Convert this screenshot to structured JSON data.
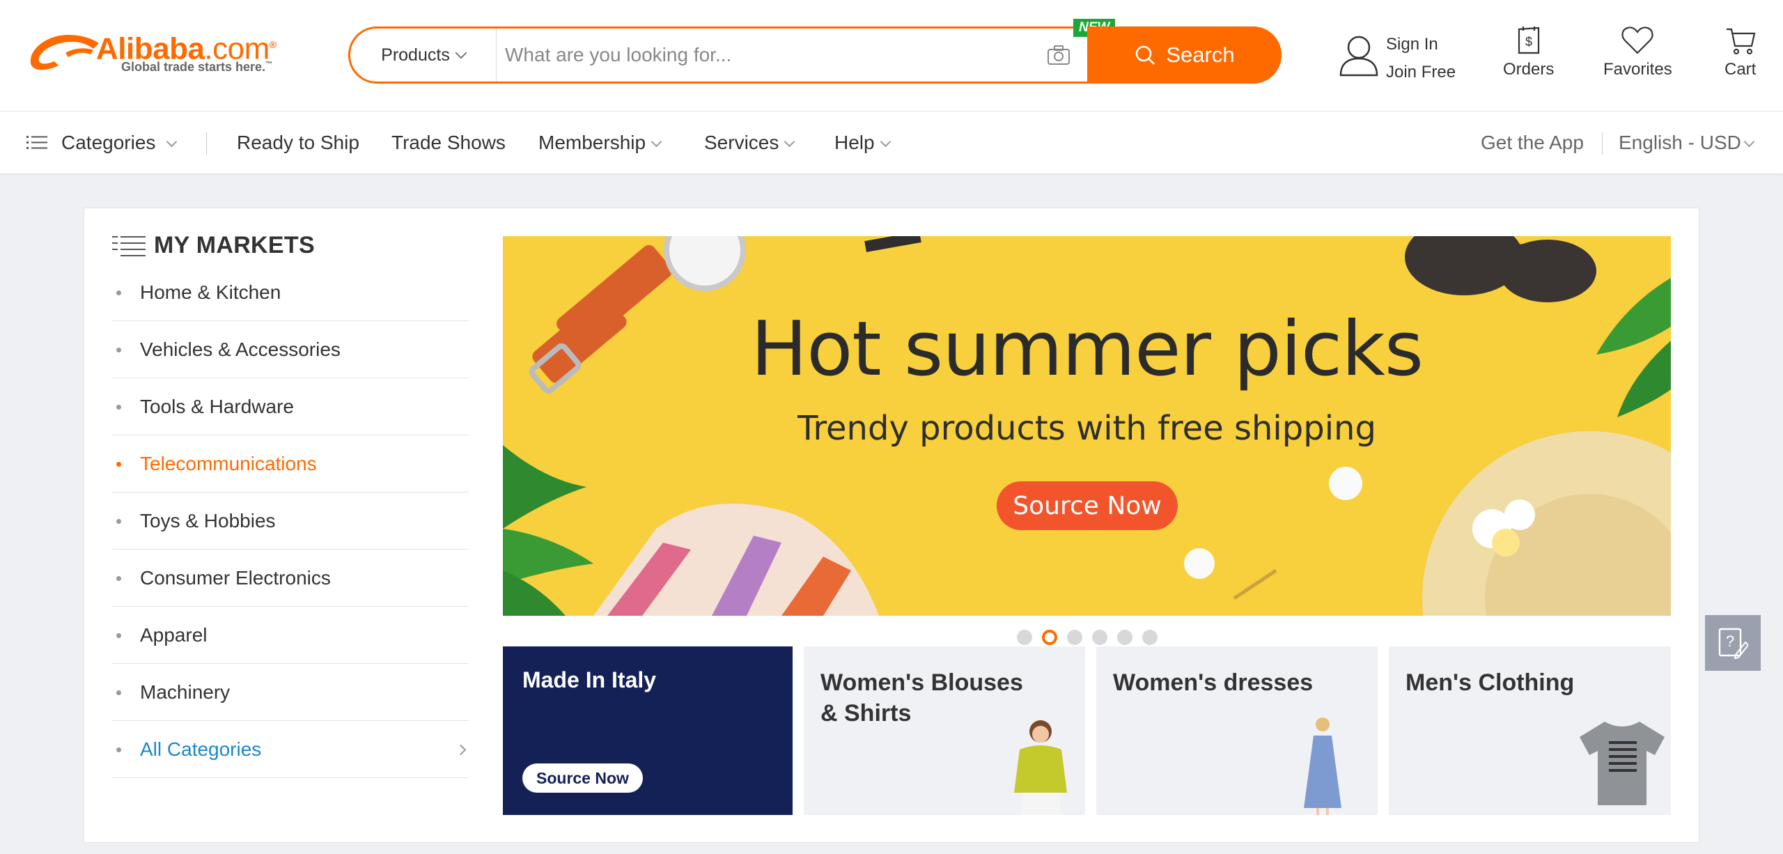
{
  "brand": {
    "logo_text": "Alibaba",
    "logo_domain": ".com",
    "logo_registered": "®",
    "tagline": "Global trade starts here.",
    "tagline_tm": "™",
    "color": "#ff6a00"
  },
  "search": {
    "category": "Products",
    "placeholder": "What are you looking for...",
    "new_badge": "NEW",
    "button_label": "Search"
  },
  "header_tools": {
    "sign_in": "Sign In",
    "join_free": "Join Free",
    "orders": "Orders",
    "favorites": "Favorites",
    "cart": "Cart"
  },
  "nav": {
    "categories": "Categories",
    "ready_to_ship": "Ready to Ship",
    "trade_shows": "Trade Shows",
    "membership": "Membership",
    "services": "Services",
    "help": "Help",
    "get_app": "Get the App",
    "language": "English - USD"
  },
  "markets": {
    "title": "MY MARKETS",
    "items": [
      {
        "label": "Home & Kitchen"
      },
      {
        "label": "Vehicles & Accessories"
      },
      {
        "label": "Tools & Hardware"
      },
      {
        "label": "Telecommunications",
        "active": true
      },
      {
        "label": "Toys & Hobbies"
      },
      {
        "label": "Consumer Electronics"
      },
      {
        "label": "Apparel"
      },
      {
        "label": "Machinery"
      },
      {
        "label": "All Categories",
        "link": true
      }
    ]
  },
  "banner": {
    "title": "Hot summer picks",
    "subtitle": "Trendy products with free shipping",
    "button": "Source Now",
    "dots_count": 6,
    "active_dot": 2
  },
  "tiles": [
    {
      "title": "Made In Italy",
      "button": "Source Now"
    },
    {
      "title": "Women's Blouses & Shirts"
    },
    {
      "title": "Women's dresses"
    },
    {
      "title": "Men's Clothing"
    }
  ]
}
